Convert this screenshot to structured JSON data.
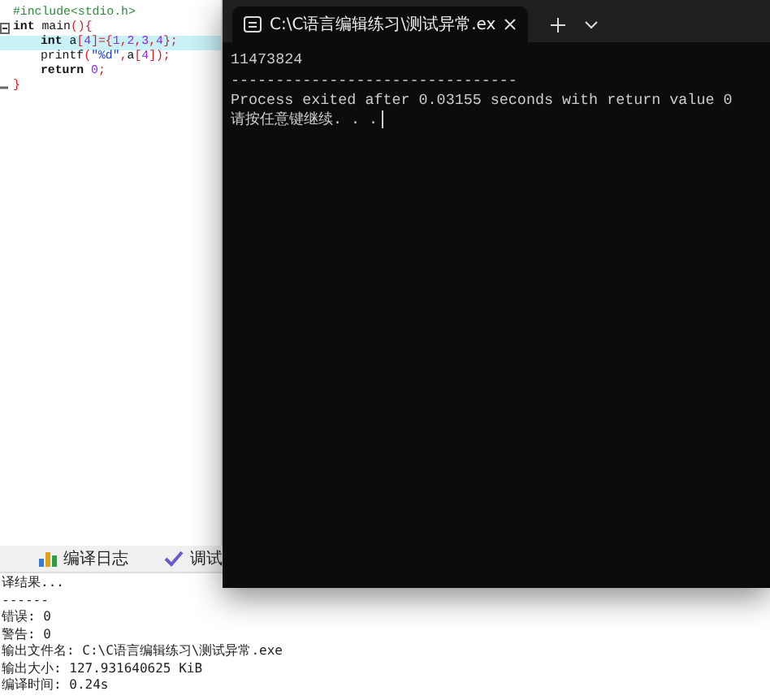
{
  "editor": {
    "lines": [
      {
        "kind": "code",
        "highlighted": false,
        "tokens": [
          {
            "text": "#include<stdio.h>",
            "kind": "directive"
          }
        ]
      },
      {
        "kind": "block_start",
        "highlighted": false,
        "tokens": [
          {
            "text": "int",
            "kind": "keyword"
          },
          {
            "text": " main",
            "kind": "plain"
          },
          {
            "text": "(){",
            "kind": "punct"
          }
        ],
        "children": [
          {
            "kind": "code",
            "highlighted": true,
            "tokens": [
              {
                "text": "int",
                "kind": "keyword"
              },
              {
                "text": " a",
                "kind": "plain"
              },
              {
                "text": "[",
                "kind": "punct"
              },
              {
                "text": "4",
                "kind": "number"
              },
              {
                "text": "]={",
                "kind": "punct"
              },
              {
                "text": "1",
                "kind": "number"
              },
              {
                "text": ",",
                "kind": "punct"
              },
              {
                "text": "2",
                "kind": "number"
              },
              {
                "text": ",",
                "kind": "punct"
              },
              {
                "text": "3",
                "kind": "number"
              },
              {
                "text": ",",
                "kind": "punct"
              },
              {
                "text": "4",
                "kind": "number"
              },
              {
                "text": "};",
                "kind": "punct"
              }
            ]
          },
          {
            "kind": "code",
            "highlighted": false,
            "tokens": [
              {
                "text": "printf",
                "kind": "plain"
              },
              {
                "text": "(",
                "kind": "punct"
              },
              {
                "text": "\"%d\"",
                "kind": "string"
              },
              {
                "text": ",",
                "kind": "punct"
              },
              {
                "text": "a",
                "kind": "plain"
              },
              {
                "text": "[",
                "kind": "punct"
              },
              {
                "text": "4",
                "kind": "number"
              },
              {
                "text": "]);",
                "kind": "punct"
              }
            ]
          },
          {
            "kind": "code",
            "highlighted": false,
            "tokens": [
              {
                "text": "return",
                "kind": "keyword"
              },
              {
                "text": " 0",
                "kind": "number"
              },
              {
                "text": ";",
                "kind": "punct"
              }
            ]
          }
        ]
      },
      {
        "kind": "block_end",
        "highlighted": false,
        "tokens": [
          {
            "text": "}",
            "kind": "punct"
          }
        ]
      }
    ]
  },
  "terminal": {
    "tab_title": "C:\\C语言编辑练习\\测试异常.ex",
    "output": [
      "11473824",
      "--------------------------------",
      "Process exited after 0.03155 seconds with return value 0",
      "请按任意键继续. . ."
    ]
  },
  "log_panel": {
    "tabs": [
      {
        "label": "编译日志",
        "kind": "chart"
      },
      {
        "label": "调试",
        "kind": "check"
      }
    ],
    "lines": [
      "译结果...",
      "------",
      "错误: 0",
      "警告: 0",
      "输出文件名: C:\\C语言编辑练习\\测试异常.exe",
      "输出大小: 127.931640625 KiB",
      "编译时间: 0.24s"
    ]
  }
}
